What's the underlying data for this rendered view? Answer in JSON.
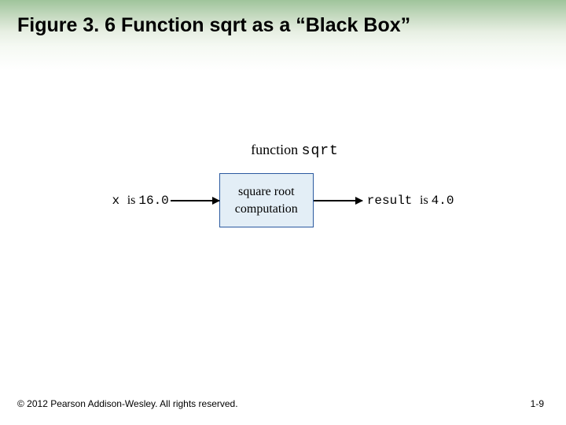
{
  "title": "Figure 3. 6  Function sqrt as a “Black Box”",
  "diagram": {
    "func_word": "function",
    "func_name": "sqrt",
    "input_prefix": "x ",
    "input_is": "is ",
    "input_value": "16.0",
    "box_line1": "square root",
    "box_line2": "computation",
    "output_prefix": "result ",
    "output_is": "is ",
    "output_value": "4.0"
  },
  "footer": {
    "copyright": "© 2012 Pearson Addison-Wesley. All rights reserved.",
    "page": "1-9"
  }
}
